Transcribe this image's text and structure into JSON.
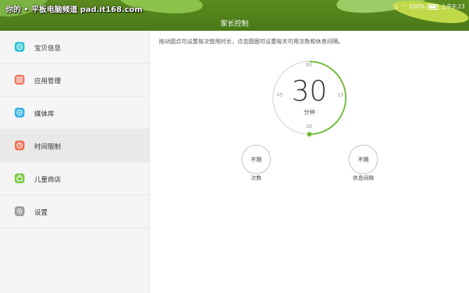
{
  "statusbar": {
    "watermark": "你的 • 平板电脑频道 pad.it168.com",
    "battery": "100%",
    "time": "上午9:23"
  },
  "header": {
    "title": "家长控制"
  },
  "sidebar": {
    "items": [
      {
        "label": "宝贝信息",
        "icon": "baby-info-icon",
        "color": "#2fc4d3"
      },
      {
        "label": "应用管理",
        "icon": "apps-icon",
        "color": "#f0745a"
      },
      {
        "label": "媒体库",
        "icon": "media-icon",
        "color": "#3ab3e5"
      },
      {
        "label": "时间限制",
        "icon": "clock-icon",
        "color": "#f0745a"
      },
      {
        "label": "儿童商店",
        "icon": "store-icon",
        "color": "#7ccc46"
      },
      {
        "label": "设置",
        "icon": "gear-icon",
        "color": "#9e9e9e"
      }
    ],
    "active_index": 3
  },
  "main": {
    "hint": "拖动圆点可设置每次使用时长，点击圆圈可设置每天可用次数和休息间隔。",
    "dial": {
      "value": "30",
      "unit": "分钟",
      "ticks": {
        "top": "60",
        "right": "15",
        "bottom": "30",
        "left": "45"
      },
      "accent": "#6cbb2e"
    },
    "count_button": {
      "label": "不限",
      "caption": "次数"
    },
    "rest_button": {
      "label": "不限",
      "caption": "休息间隔"
    }
  }
}
